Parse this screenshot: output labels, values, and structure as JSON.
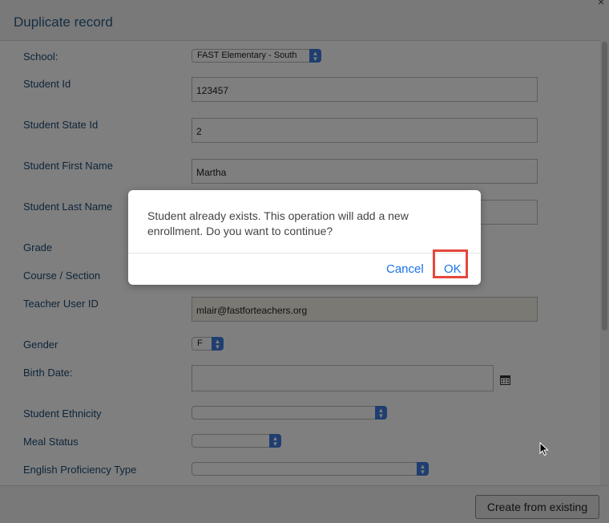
{
  "window": {
    "title": "Duplicate record",
    "close_glyph": "×"
  },
  "form": {
    "school": {
      "label": "School:",
      "value": "FAST Elementary - South"
    },
    "student_id": {
      "label": "Student Id",
      "value": "123457"
    },
    "student_state_id": {
      "label": "Student State Id",
      "value": "2"
    },
    "first_name": {
      "label": "Student First Name",
      "value": "Martha"
    },
    "last_name": {
      "label": "Student Last Name",
      "value": ""
    },
    "grade": {
      "label": "Grade"
    },
    "course_section": {
      "label": "Course / Section"
    },
    "teacher_user_id": {
      "label": "Teacher User ID",
      "value": "mlair@fastforteachers.org"
    },
    "gender": {
      "label": "Gender",
      "value": "F"
    },
    "birth_date": {
      "label": "Birth Date:",
      "value": ""
    },
    "ethnicity": {
      "label": "Student Ethnicity",
      "value": ""
    },
    "meal_status": {
      "label": "Meal Status",
      "value": ""
    },
    "english_proficiency": {
      "label": "English Proficiency Type",
      "value": ""
    }
  },
  "footer": {
    "create_label": "Create from existing"
  },
  "dialog": {
    "message": "Student already exists. This operation will add a new enrollment. Do you want to continue?",
    "cancel_label": "Cancel",
    "ok_label": "OK",
    "highlight_color": "#e5473d"
  },
  "colors": {
    "accent": "#1a73e8",
    "select_arrow": "#3f7de0",
    "label": "#1d4a72"
  }
}
